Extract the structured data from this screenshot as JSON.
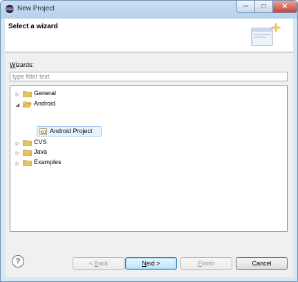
{
  "window": {
    "title": "New Project",
    "title_icon": "eclipse-icon"
  },
  "banner": {
    "title": "Select a wizard",
    "icon": "wizard-banner-icon"
  },
  "filter": {
    "label_mnemonic": "W",
    "label_rest": "izards:",
    "placeholder": "type filter text"
  },
  "tree": [
    {
      "label": "General",
      "expanded": false,
      "icon": "folder-icon"
    },
    {
      "label": "Android",
      "expanded": true,
      "icon": "folder-icon",
      "children": [
        {
          "label": "Android Project",
          "icon": "android-project-icon",
          "selected": true
        }
      ]
    },
    {
      "label": "CVS",
      "expanded": false,
      "icon": "folder-icon"
    },
    {
      "label": "Java",
      "expanded": false,
      "icon": "folder-icon"
    },
    {
      "label": "Examples",
      "expanded": false,
      "icon": "folder-icon"
    }
  ],
  "buttons": {
    "help": "?",
    "back": {
      "prefix": "< ",
      "mnemonic": "B",
      "rest": "ack",
      "enabled": false
    },
    "next": {
      "mnemonic": "N",
      "rest": "ext >",
      "enabled": true
    },
    "finish": {
      "mnemonic": "F",
      "rest": "inish",
      "enabled": false
    },
    "cancel": {
      "label": "Cancel",
      "enabled": true
    }
  },
  "colors": {
    "title_bar": "#b7d1ea",
    "selection": "#eaf3fc",
    "close_button": "#c4433a"
  }
}
